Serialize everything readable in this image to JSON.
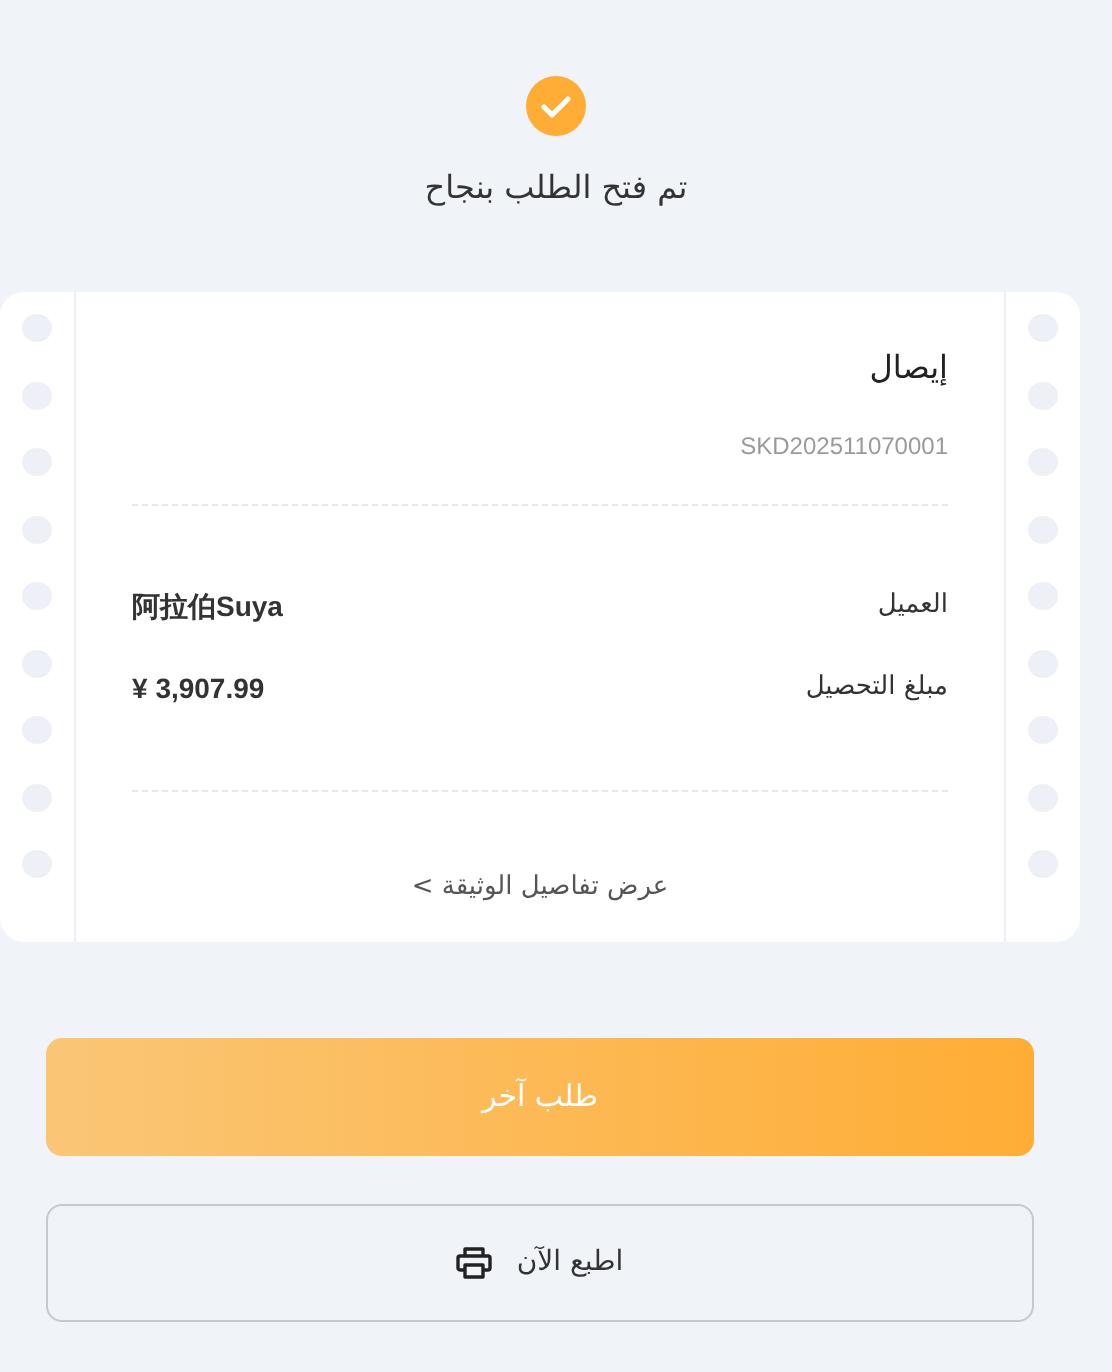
{
  "status": {
    "message": "تم فتح الطلب بنجاح"
  },
  "receipt": {
    "title": "إيصال",
    "number": "SKD202511070001",
    "rows": [
      {
        "label": "العميل",
        "value": "阿拉伯Suya"
      },
      {
        "label": "مبلغ التحصيل",
        "value": "3,907.99 ¥"
      }
    ],
    "details_link": "عرض تفاصيل الوثيقة >"
  },
  "buttons": [
    {
      "kind": "primary",
      "label": "طلب آخر"
    },
    {
      "kind": "print",
      "label": "اطبع الآن"
    }
  ]
}
